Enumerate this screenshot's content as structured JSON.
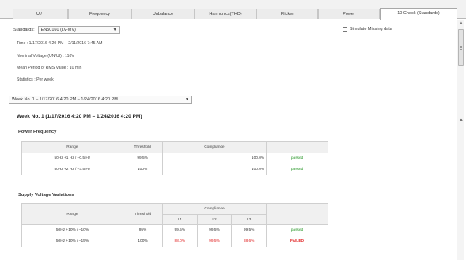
{
  "tabs": [
    {
      "label": "U / I"
    },
    {
      "label": "Frequency"
    },
    {
      "label": "Unbalance"
    },
    {
      "label": "Harmonics(THD)"
    },
    {
      "label": "Flicker"
    },
    {
      "label": "Power"
    },
    {
      "label": "10 Check (Standards)"
    }
  ],
  "standards": {
    "label": "Standards:",
    "value": "EN50160 (LV-MV)"
  },
  "ensure_missing": {
    "label": "Simulate Missing data"
  },
  "info": {
    "time": "Time :  1/17/2016 4:20 PM – 2/11/2016 7:45 AM",
    "nominal_voltage": "Nominal Voltage (UN/UI) :  110V",
    "mean_period": "Mean Period of RMS Value :  10 min",
    "statistics": "Statistics :  Per week"
  },
  "week_select": {
    "value": "Week No. 1 – 1/17/2016 4:20 PM – 1/24/2016 4:20 PM"
  },
  "week_title": "Week No. 1 (1/17/2016 4:20 PM – 1/24/2016 4:20 PM)",
  "power_frequency": {
    "title": "Power Frequency",
    "headers": [
      "Range",
      "Threshold",
      "Compliance",
      ""
    ],
    "rows": [
      {
        "range": "50Hz +1 Hz / –0.5 Hz",
        "threshold": "99.5%",
        "compliance": "100.0%",
        "status": "passed"
      },
      {
        "range": "50Hz +2 Hz / –3.5 Hz",
        "threshold": "100%",
        "compliance": "100.0%",
        "status": "passed"
      }
    ]
  },
  "supply_voltage": {
    "title": "Supply Voltage Variations",
    "headers": [
      "Range",
      "Threshold",
      "Compliance",
      ""
    ],
    "subheaders": [
      "L1",
      "L2",
      "L3"
    ],
    "rows": [
      {
        "range": "50Hz +10% / –10%",
        "threshold": "95%",
        "l1": "99.5%",
        "l2": "99.5%",
        "l3": "99.5%",
        "status": "passed",
        "status_type": "pass"
      },
      {
        "range": "50Hz +10% / –15%",
        "threshold": "100%",
        "l1": "88.0%",
        "l2": "99.5%",
        "l3": "88.6%",
        "status": "FAILED",
        "status_type": "fail"
      }
    ]
  },
  "colors": {
    "pass": "#2e9a2e",
    "fail": "#e02020"
  }
}
